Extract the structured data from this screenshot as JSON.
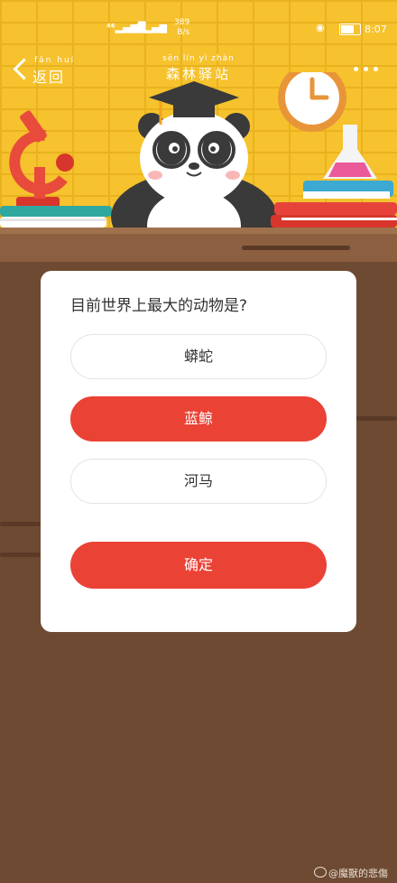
{
  "status_bar": {
    "signal_1": "⁴⁶",
    "signal_2": "⁴⁶",
    "net_speed": "389",
    "net_unit": "B/s",
    "time": "8:07"
  },
  "nav": {
    "back_pinyin": "fǎn huí",
    "back_label": "返回",
    "title_pinyin": "sēn lín yì zhàn",
    "title": "森林驿站"
  },
  "quiz": {
    "question": "目前世界上最大的动物是?",
    "options": [
      {
        "label": "蟒蛇",
        "selected": false
      },
      {
        "label": "蓝鲸",
        "selected": true
      },
      {
        "label": "河马",
        "selected": false
      }
    ],
    "confirm_label": "确定"
  },
  "watermark": {
    "text": "@魔獸的悲傷"
  },
  "colors": {
    "header_bg": "#f6c22d",
    "accent_red": "#ea4235",
    "desk_brown": "#6e4a32"
  },
  "icons": [
    "back-chevron-icon",
    "more-dots-icon",
    "eye-icon",
    "battery-icon",
    "wifi-icon"
  ]
}
